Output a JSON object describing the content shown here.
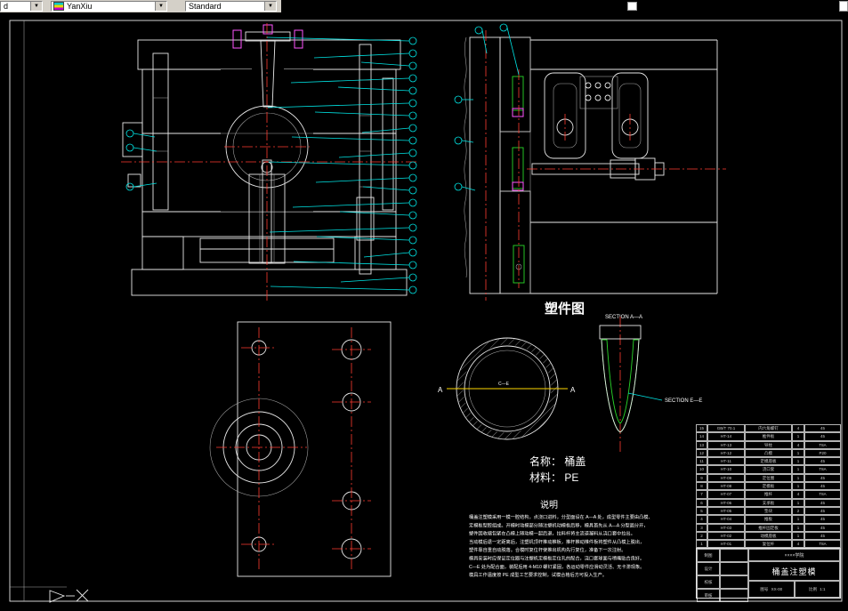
{
  "colors": {
    "annotation": "#00e5e5",
    "centerline": "#ff3b30",
    "part_section": "#2ad82a",
    "section_line": "#ffd700",
    "pin_highlight": "#ff55ff",
    "line": "#e8e8e8"
  },
  "toolbar": {
    "combo1_value": "d",
    "layer_value": "YanXiu",
    "style_value": "Standard",
    "dropdown_arrow": "▼"
  },
  "drawing": {
    "part_figure_title": "塑件图",
    "section_a_label": "SECTION A—A",
    "section_e_label": "SECTION E—E",
    "marker_a": "A",
    "marker_ce": "C—E",
    "name_line": "名称： 桶盖",
    "material_line": "材料： PE",
    "notes": {
      "title": "说明",
      "lines": [
        "桶盖注塑模采用一模一腔结构，点浇口进料，分型面设在 A—A 处，成型零件主要由凸模、",
        "定模板型腔组成。开模时动模部分随注塑机动模板后移，模具首先从 A—A 分型面分开，",
        "塑件因收缩包紧在凸模上随动模一起后退，拉料杆将主流道凝料从浇口套中拉出。",
        "当动模后退一定距离后，注塑机顶杆推动推板，推杆推动推件板将塑件从凸模上脱出，",
        "塑件靠自重自动脱落。合模时复位杆使推出机构先行复位，准备下一次注射。",
        "模具安装时应保证定位圈与注塑机定模板定位孔的配合，浇口套球面与喷嘴贴合良好。",
        "C—E 处为配合面，装配后用 4-M10 螺钉紧固，各运动零件应滑动灵活、无卡滞现象。",
        "模具工作温度按 PE 成型工艺要求控制，试模合格后方可投入生产。"
      ]
    },
    "title_block": {
      "org": "××××学院",
      "title": "桶盖注塑模",
      "no_label": "图号",
      "no": "XX-00",
      "scale_label": "比例",
      "scale": "1:1",
      "rows_left": [
        "制图",
        "设计",
        "校核",
        "审核"
      ],
      "parts": [
        [
          "15",
          "GB/T 70.1",
          "内六角螺钉",
          "4",
          "45"
        ],
        [
          "14",
          "HT-14",
          "推件板",
          "1",
          "45"
        ],
        [
          "13",
          "HT-13",
          "导柱",
          "4",
          "T8A"
        ],
        [
          "12",
          "HT-12",
          "凸模",
          "1",
          "P20"
        ],
        [
          "11",
          "HT-11",
          "定模座板",
          "1",
          "45"
        ],
        [
          "10",
          "HT-10",
          "浇口套",
          "1",
          "T8A"
        ],
        [
          "9",
          "HT-09",
          "定位圈",
          "1",
          "45"
        ],
        [
          "8",
          "HT-08",
          "定模板",
          "1",
          "45"
        ],
        [
          "7",
          "HT-07",
          "推杆",
          "4",
          "T8A"
        ],
        [
          "6",
          "HT-06",
          "支承板",
          "1",
          "45"
        ],
        [
          "5",
          "HT-05",
          "垫块",
          "2",
          "45"
        ],
        [
          "4",
          "HT-04",
          "推板",
          "1",
          "45"
        ],
        [
          "3",
          "HT-03",
          "推杆固定板",
          "1",
          "45"
        ],
        [
          "2",
          "HT-02",
          "动模座板",
          "1",
          "45"
        ],
        [
          "1",
          "HT-01",
          "复位杆",
          "4",
          "T8A"
        ]
      ]
    }
  }
}
